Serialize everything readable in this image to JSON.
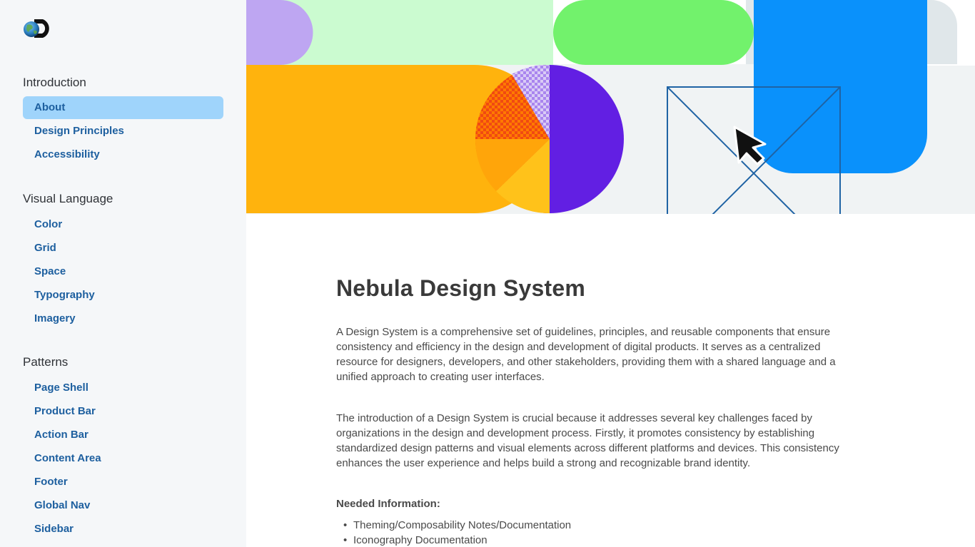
{
  "brand": {
    "logo_icon": "discovery-globe-logo"
  },
  "sidebar": {
    "sections": [
      {
        "title": "Introduction",
        "items": [
          "About",
          "Design Principles",
          "Accessibility"
        ]
      },
      {
        "title": "Visual Language",
        "items": [
          "Color",
          "Grid",
          "Space",
          "Typography",
          "Imagery"
        ]
      },
      {
        "title": "Patterns",
        "items": [
          "Page Shell",
          "Product Bar",
          "Action Bar",
          "Content Area",
          "Footer",
          "Global Nav",
          "Sidebar"
        ]
      }
    ],
    "active_item": "About"
  },
  "hero": {
    "illustration": "abstract-shapes-cursor",
    "colors": {
      "lavender": "#bea6f2",
      "mint": "#cbfbd0",
      "green": "#72f26c",
      "blue": "#0a91fb",
      "orange": "#ffb30d",
      "purple": "#621fe3",
      "grey": "#f0f3f4",
      "outline": "#1f63a4"
    }
  },
  "main": {
    "title": "Nebula Design System",
    "paragraphs": [
      "A Design System is a comprehensive set of guidelines, principles, and reusable components that ensure consistency and efficiency in the design and development of digital products. It serves as a centralized resource for designers, developers, and other stakeholders, providing them with a shared language and a unified approach to creating user interfaces.",
      "The introduction of a Design System is crucial because it addresses several key challenges faced by organizations in the design and development process. Firstly, it promotes consistency by establishing standardized design patterns and visual elements across different platforms and devices. This consistency enhances the user experience and helps build a strong and recognizable brand identity."
    ],
    "needed_heading": "Needed Information:",
    "bullets": [
      "Theming/Composability Notes/Documentation",
      "Iconography Documentation"
    ],
    "bullet_glyph": "•"
  }
}
